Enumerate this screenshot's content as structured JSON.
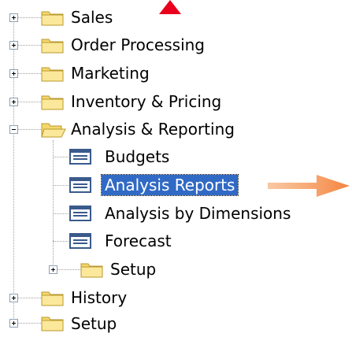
{
  "tree": {
    "items": [
      {
        "label": "Sales",
        "icon": "folder-closed-icon",
        "expanded": false
      },
      {
        "label": "Order Processing",
        "icon": "folder-closed-icon",
        "expanded": false
      },
      {
        "label": "Marketing",
        "icon": "folder-closed-icon",
        "expanded": false
      },
      {
        "label": "Inventory & Pricing",
        "icon": "folder-closed-icon",
        "expanded": false
      },
      {
        "label": "Analysis & Reporting",
        "icon": "folder-open-icon",
        "expanded": true
      },
      {
        "label": "Budgets",
        "icon": "form-icon"
      },
      {
        "label": "Analysis Reports",
        "icon": "form-icon",
        "selected": true
      },
      {
        "label": "Analysis by Dimensions",
        "icon": "form-icon"
      },
      {
        "label": "Forecast",
        "icon": "form-icon"
      },
      {
        "label": "Setup",
        "icon": "folder-closed-icon",
        "expanded": false
      },
      {
        "label": "History",
        "icon": "folder-closed-icon",
        "expanded": false
      },
      {
        "label": "Setup",
        "icon": "folder-closed-icon",
        "expanded": false
      }
    ]
  },
  "colors": {
    "selection": "#316ac5",
    "annotation_arrow": "#f4843f",
    "annotation_marker_top": "#e8001c"
  }
}
